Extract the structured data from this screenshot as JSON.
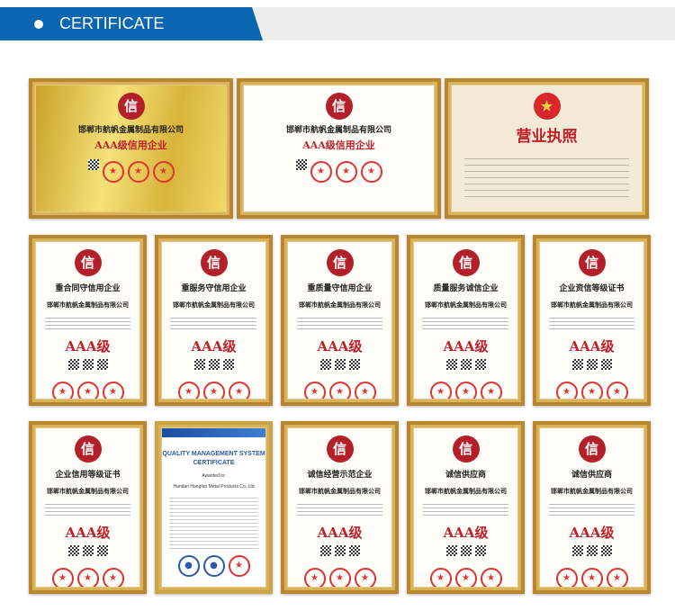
{
  "header": {
    "title": "CERTIFICATE"
  },
  "company": "邯郸市航帆金属制品有限公司",
  "row1": [
    {
      "title": "邯郸市航帆金属制品有限公司",
      "subtitle": "AAA级信用企业",
      "style": "gold"
    },
    {
      "title": "邯郸市航帆金属制品有限公司",
      "subtitle": "AAA级信用企业",
      "style": "white"
    },
    {
      "title": "",
      "subtitle": "营业执照",
      "style": "license"
    }
  ],
  "row2": [
    {
      "title": "重合同守信用企业",
      "grade": "AAA级"
    },
    {
      "title": "重服务守信用企业",
      "grade": "AAA级"
    },
    {
      "title": "重质量守信用企业",
      "grade": "AAA级"
    },
    {
      "title": "质量服务诚信企业",
      "grade": "AAA级"
    },
    {
      "title": "企业资信等级证书",
      "grade": "AAA级"
    }
  ],
  "row3": [
    {
      "title": "企业信用等级证书",
      "grade": "AAA级"
    },
    {
      "title": "QUALITY MANAGEMENT SYSTEM CERTIFICATE",
      "awarded": "Awarded to:",
      "company_en": "Handan Hangfan Metal Products Co.,Ltd"
    },
    {
      "title": "诚信经营示范企业",
      "grade": "AAA级"
    },
    {
      "title": "诚信供应商",
      "grade": "AAA级"
    },
    {
      "title": "诚信供应商",
      "grade": "AAA级"
    }
  ]
}
